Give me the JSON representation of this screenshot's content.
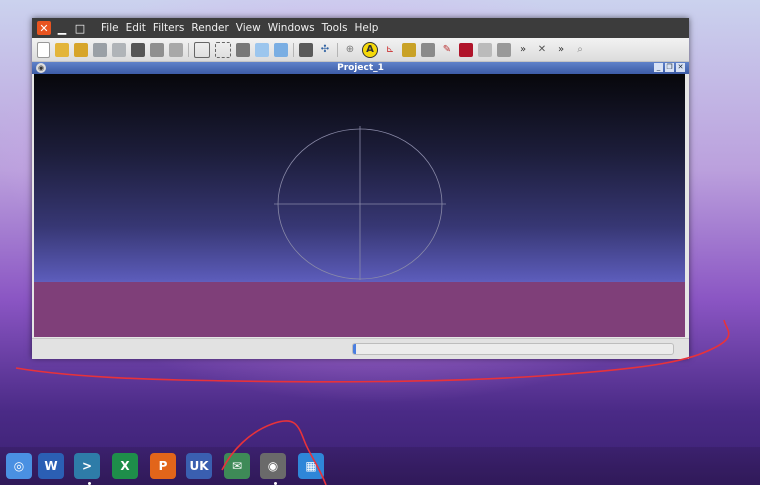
{
  "window": {
    "menu": [
      "File",
      "Edit",
      "Filters",
      "Render",
      "View",
      "Windows",
      "Tools",
      "Help"
    ],
    "toolbar_icons": [
      "new-document-icon",
      "open-folder-icon",
      "open-folder-alt-icon",
      "import-icon",
      "export-icon",
      "snapshot-icon",
      "layers-icon",
      "layers-alt-icon",
      "bounding-box-icon",
      "selection-icon",
      "select-vertex-icon",
      "cylinder-icon",
      "cylinder-alt-icon",
      "cube-icon",
      "axis-icon",
      "sphere-icon",
      "annotate-icon",
      "measure-icon",
      "paint-icon",
      "texture-icon",
      "brush-icon",
      "color-picker-icon",
      "transform-icon",
      "mesh-icon",
      "more-icon",
      "tools-icon",
      "more-icon",
      "search-icon"
    ],
    "subwindow_title": "Project_1",
    "toolbar_extra_glyph": "A"
  },
  "progress": {
    "value": 0.01
  },
  "dock": {
    "items": [
      {
        "name": "dock-chromium-icon",
        "glyph": "◎",
        "color": "#4a90e2"
      },
      {
        "name": "dock-word-icon",
        "glyph": "W",
        "color": "#2b5fb4"
      },
      {
        "name": "dock-terminal-icon",
        "glyph": ">",
        "color": "#2e7ca8"
      },
      {
        "name": "dock-excel-icon",
        "glyph": "X",
        "color": "#1e8e4a"
      },
      {
        "name": "dock-powerpoint-icon",
        "glyph": "P",
        "color": "#e2651a"
      },
      {
        "name": "dock-store-icon",
        "glyph": "UK",
        "color": "#3a5fb0"
      },
      {
        "name": "dock-mail-icon",
        "glyph": "✉",
        "color": "#3e8a57"
      },
      {
        "name": "dock-meshlab-icon",
        "glyph": "◉",
        "color": "#6a6a6a"
      },
      {
        "name": "dock-apps-icon",
        "glyph": "▦",
        "color": "#2f86d8"
      }
    ]
  },
  "colors": {
    "annotation": "#e8323a"
  }
}
